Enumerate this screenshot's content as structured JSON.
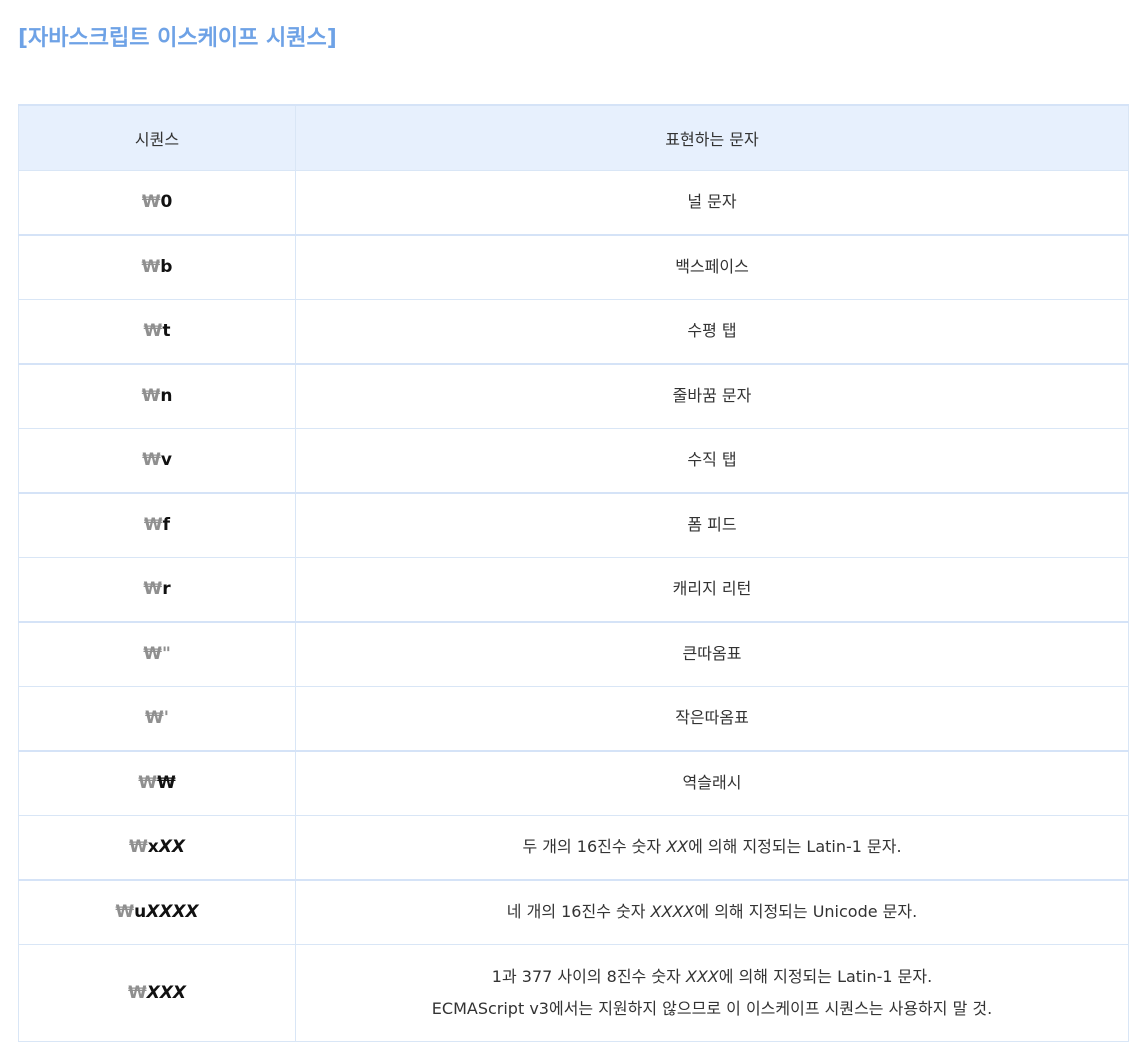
{
  "title": "[자바스크립트 이스케이프 시퀀스]",
  "table": {
    "headers": [
      "시퀀스",
      "표현하는 문자"
    ],
    "rows": [
      {
        "seq_prefix": "₩",
        "seq_body": "0",
        "seq_italic": "",
        "desc": "널 문자"
      },
      {
        "seq_prefix": "₩",
        "seq_body": "b",
        "seq_italic": "",
        "desc": "백스페이스"
      },
      {
        "seq_prefix": "₩",
        "seq_body": "t",
        "seq_italic": "",
        "desc": "수평 탭"
      },
      {
        "seq_prefix": "₩",
        "seq_body": "n",
        "seq_italic": "",
        "desc": "줄바꿈 문자"
      },
      {
        "seq_prefix": "₩",
        "seq_body": "v",
        "seq_italic": "",
        "desc": "수직 탭"
      },
      {
        "seq_prefix": "₩",
        "seq_body": "f",
        "seq_italic": "",
        "desc": "폼 피드"
      },
      {
        "seq_prefix": "₩",
        "seq_body": "r",
        "seq_italic": "",
        "desc": "캐리지 리턴"
      },
      {
        "seq_prefix": "₩",
        "seq_body": "\"",
        "seq_italic": "",
        "desc": "큰따옴표"
      },
      {
        "seq_prefix": "₩",
        "seq_body": "'",
        "seq_italic": "",
        "desc": "작은따옴표"
      },
      {
        "seq_prefix": "₩",
        "seq_body": "₩",
        "seq_italic": "",
        "desc": "역슬래시"
      },
      {
        "seq_prefix": "₩",
        "seq_body": "x",
        "seq_italic": "XX",
        "desc_parts": [
          "두 개의 16진수 숫자 ",
          "XX",
          "에 의해 지정되는 Latin-1 문자."
        ]
      },
      {
        "seq_prefix": "₩",
        "seq_body": "u",
        "seq_italic": "XXXX",
        "desc_parts": [
          "네 개의 16진수 숫자 ",
          "XXXX",
          "에 의해 지정되는 Unicode 문자."
        ]
      },
      {
        "seq_prefix": "₩",
        "seq_body": "",
        "seq_italic": "XXX",
        "desc_parts": [
          "1과 377 사이의 8진수 숫자 ",
          "XXX",
          "에 의해 지정되는 Latin-1 문자."
        ],
        "desc_line2": "ECMAScript v3에서는 지원하지 않으므로 이 이스케이프 시퀀스는 사용하지 말 것."
      }
    ]
  }
}
